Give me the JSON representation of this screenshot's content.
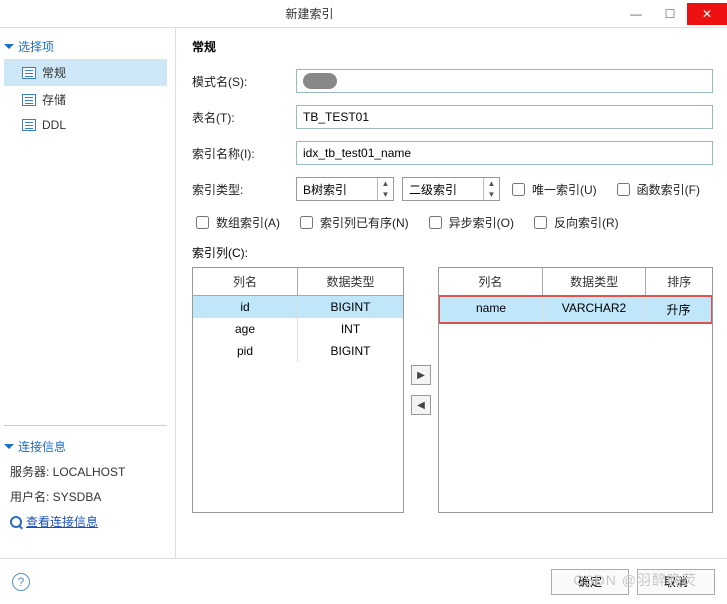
{
  "window": {
    "title": "新建索引"
  },
  "sidebar": {
    "section1_title": "选择项",
    "items": [
      {
        "label": "常规",
        "selected": true
      },
      {
        "label": "存储",
        "selected": false
      },
      {
        "label": "DDL",
        "selected": false
      }
    ],
    "section2_title": "连接信息",
    "server_label": "服务器: LOCALHOST",
    "user_label": "用户名: SYSDBA",
    "view_conn_link": "查看连接信息"
  },
  "main": {
    "heading": "常规",
    "schema_label": "模式名(S):",
    "table_label": "表名(T):",
    "table_value": "TB_TEST01",
    "indexname_label": "索引名称(I):",
    "indexname_value": "idx_tb_test01_name",
    "indextype_label": "索引类型:",
    "indextype_value": "B树索引",
    "indexlevel_value": "二级索引",
    "unique_label": "唯一索引(U)",
    "func_label": "函数索引(F)",
    "array_label": "数组索引(A)",
    "sorted_label": "索引列已有序(N)",
    "async_label": "异步索引(O)",
    "reverse_label": "反向索引(R)",
    "cols_label": "索引列(C):",
    "left_headers": {
      "name": "列名",
      "type": "数据类型"
    },
    "left_rows": [
      {
        "name": "id",
        "type": "BIGINT",
        "selected": true
      },
      {
        "name": "age",
        "type": "INT",
        "selected": false
      },
      {
        "name": "pid",
        "type": "BIGINT",
        "selected": false
      }
    ],
    "right_headers": {
      "name": "列名",
      "type": "数据类型",
      "order": "排序"
    },
    "right_rows": [
      {
        "name": "name",
        "type": "VARCHAR2",
        "order": "升序"
      }
    ]
  },
  "footer": {
    "ok": "确定",
    "cancel": "取消"
  },
  "watermark": "CSDN @羽醉晚荧"
}
